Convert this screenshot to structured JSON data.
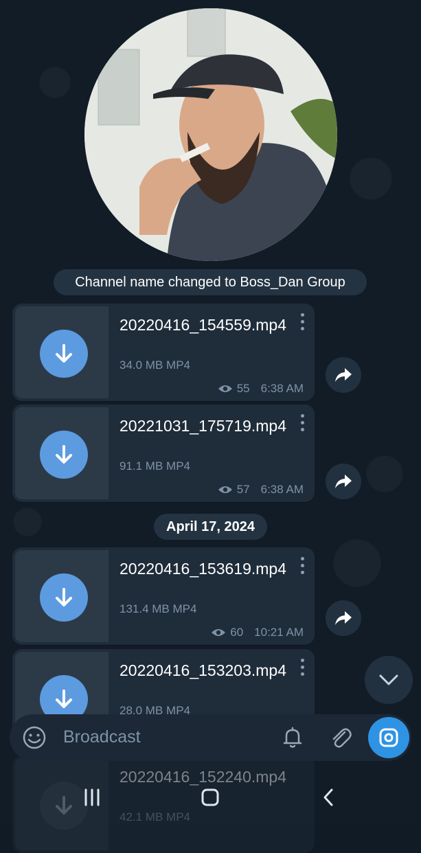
{
  "service_message": "Channel name changed to Boss_Dan Group",
  "date_separator": "April 17, 2024",
  "messages_top": [
    {
      "filename": "20220416_154559.mp4",
      "size": "34.0 MB MP4",
      "views": "55",
      "time": "6:38 AM"
    },
    {
      "filename": "20221031_175719.mp4",
      "size": "91.1 MB MP4",
      "views": "57",
      "time": "6:38 AM"
    }
  ],
  "messages_bottom": [
    {
      "filename": "20220416_153619.mp4",
      "size": "131.4 MB MP4",
      "views": "60",
      "time": "10:21 AM"
    },
    {
      "filename": "20220416_153203.mp4",
      "size": "28.0 MB MP4",
      "views": "",
      "time": ""
    },
    {
      "filename": "20220416_152240.mp4",
      "size": "42.1 MB MP4",
      "views": "",
      "time": ""
    }
  ],
  "composer": {
    "placeholder": "Broadcast"
  },
  "icons": {
    "download": "download-arrow-icon",
    "forward": "forward-icon",
    "views": "eye-icon",
    "menu": "kebab-menu-icon",
    "emoji": "emoji-icon",
    "bell": "bell-icon",
    "attach": "paperclip-icon",
    "camera": "camera-icon",
    "scroll": "chevron-down-icon"
  },
  "colors": {
    "accent": "#2f93e4",
    "download": "#5d9be0",
    "bubble": "#1f2c3a",
    "background": "#121c27"
  }
}
